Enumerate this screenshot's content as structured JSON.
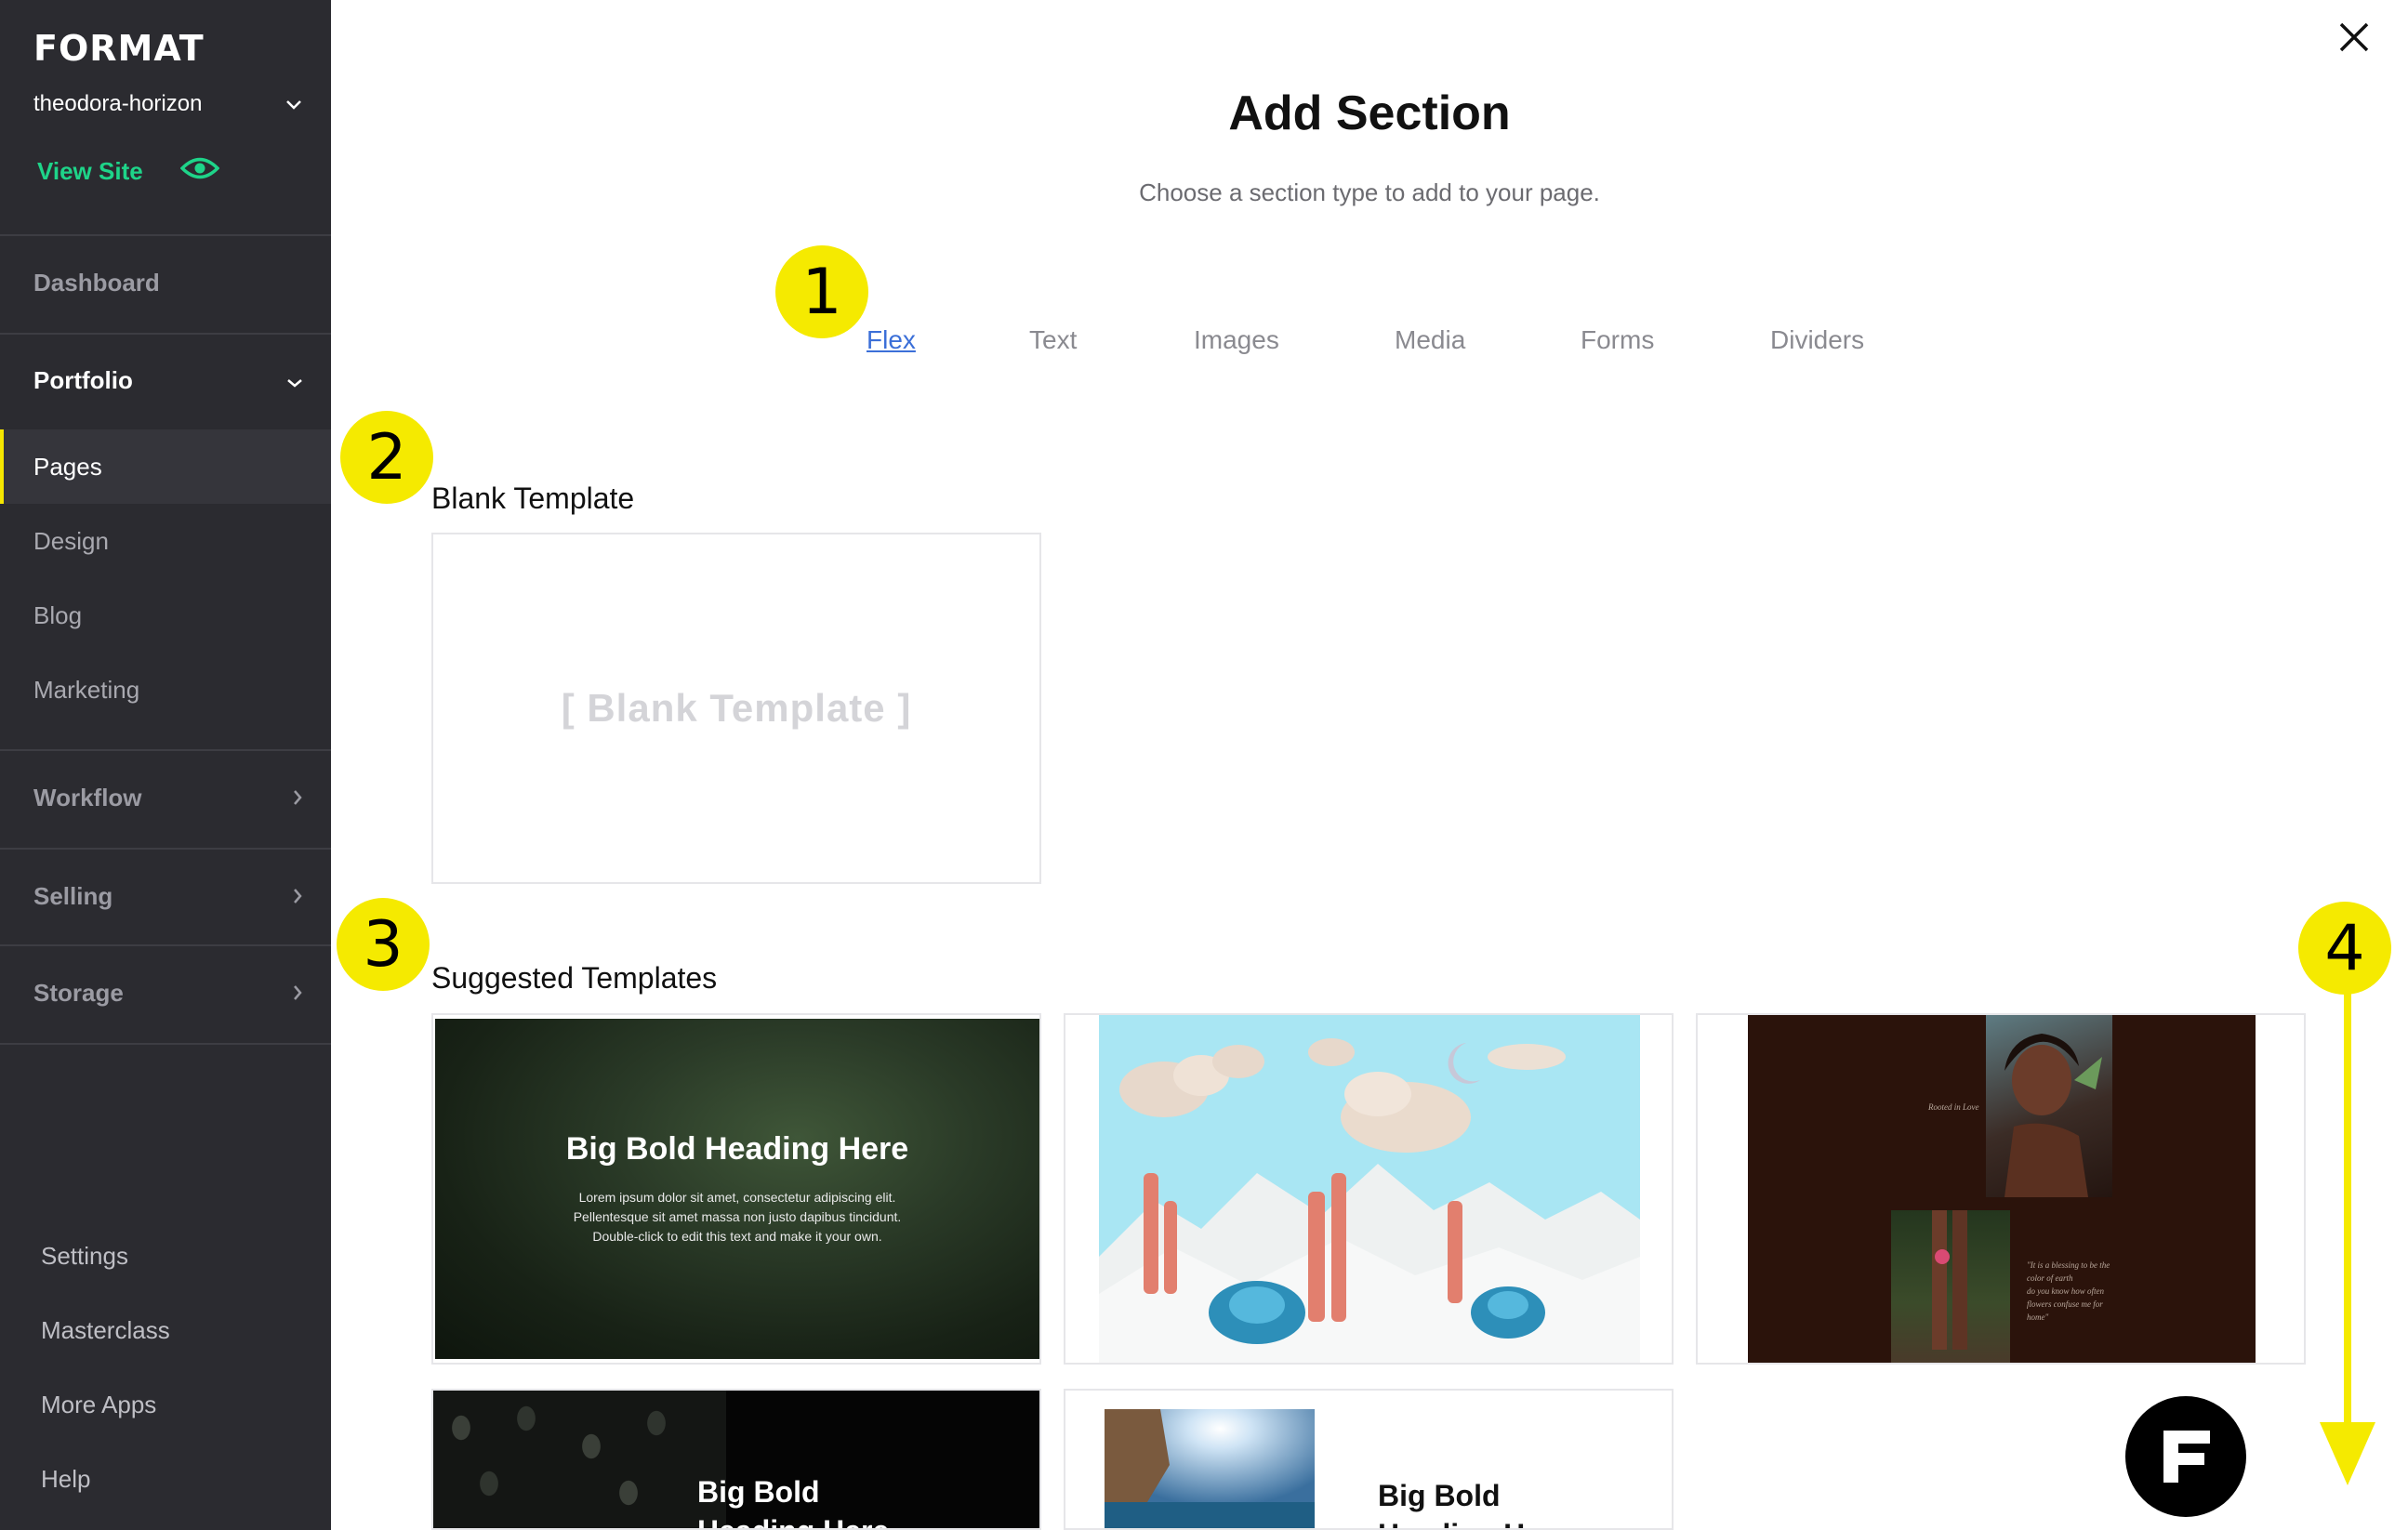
{
  "sidebar": {
    "logo": "FORMAT",
    "site_name": "theodora-horizon",
    "view_site": "View Site",
    "items": [
      {
        "label": "Dashboard"
      },
      {
        "label": "Portfolio"
      },
      {
        "label": "Pages"
      },
      {
        "label": "Design"
      },
      {
        "label": "Blog"
      },
      {
        "label": "Marketing"
      },
      {
        "label": "Workflow"
      },
      {
        "label": "Selling"
      },
      {
        "label": "Storage"
      }
    ],
    "bottom": [
      {
        "label": "Settings"
      },
      {
        "label": "Masterclass"
      },
      {
        "label": "More Apps"
      },
      {
        "label": "Help"
      }
    ],
    "accent": "#1ed489",
    "active_marker": "#f5e600"
  },
  "dialog": {
    "title": "Add Section",
    "subtitle": "Choose a section type to add to your page.",
    "tabs": [
      {
        "label": "Flex",
        "active": true
      },
      {
        "label": "Text"
      },
      {
        "label": "Images"
      },
      {
        "label": "Media"
      },
      {
        "label": "Forms"
      },
      {
        "label": "Dividers"
      }
    ],
    "blank_section": {
      "label": "Blank Template",
      "card_text": "[   Blank Template   ]"
    },
    "suggested": {
      "label": "Suggested Templates",
      "cards": [
        {
          "heading": "Big Bold Heading Here",
          "lines": [
            "Lorem ipsum dolor sit amet, consectetur adipiscing elit.",
            "Pellentesque sit amet massa non justo dapibus tincidunt.",
            "Double-click to edit this text and make it your own."
          ]
        },
        {
          "alt": "3D clouds and mountains illustration"
        },
        {
          "caption": "Rooted in Love",
          "quote": [
            "\"It is a blessing to be the",
            "color of earth",
            "do you know how often",
            "flowers confuse me for",
            "home\""
          ]
        },
        {
          "heading_1": "Big Bold",
          "heading_2": "Heading Here"
        },
        {
          "heading_1": "Big Bold",
          "heading_2": "Heading Here"
        }
      ]
    }
  },
  "annotations": [
    "1",
    "2",
    "3",
    "4"
  ],
  "annotation_color": "#f5ea00"
}
